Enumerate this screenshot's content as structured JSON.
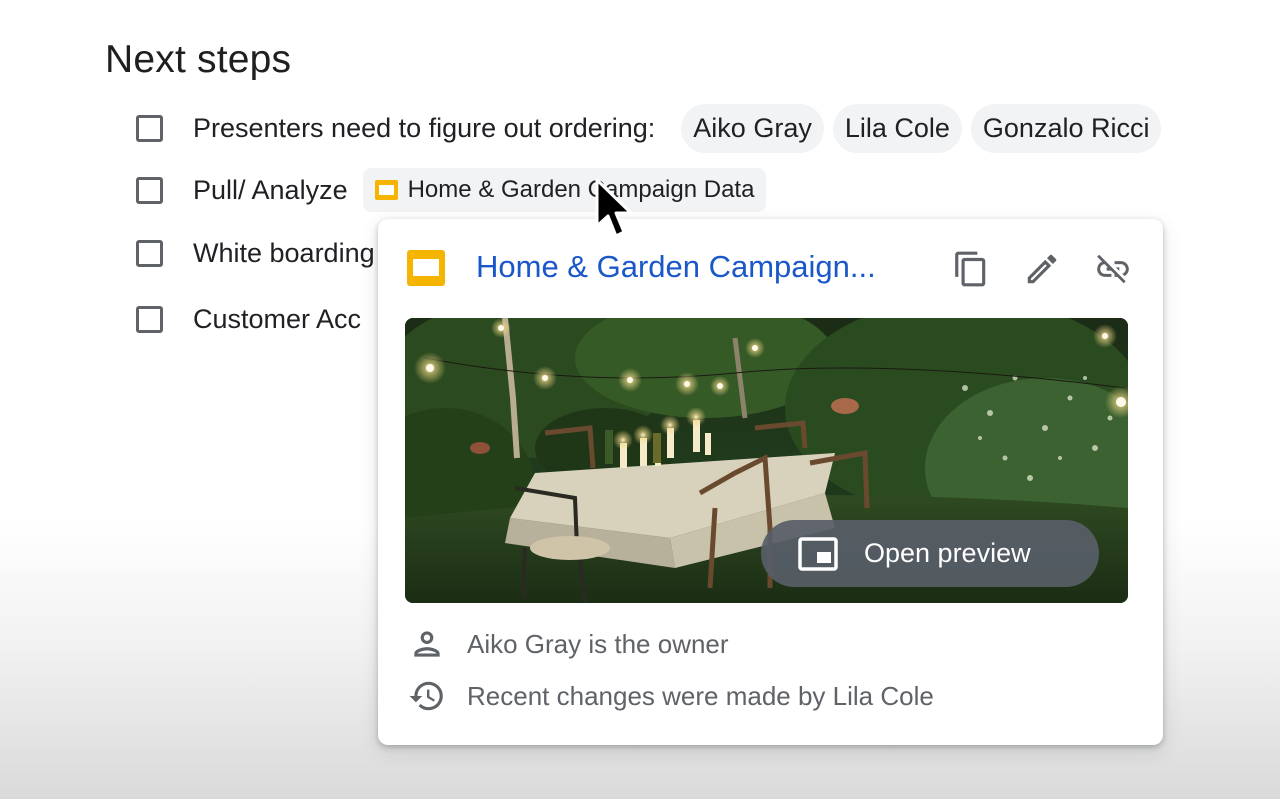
{
  "heading": "Next steps",
  "tasks": [
    {
      "text": "Presenters need to figure out ordering:",
      "chips": [
        "Aiko Gray",
        "Lila Cole",
        "Gonzalo Ricci"
      ]
    },
    {
      "text": "Pull/ Analyze",
      "file_chip": "Home & Garden Campaign Data"
    },
    {
      "text": "White boarding"
    },
    {
      "text": "Customer Acc"
    }
  ],
  "card": {
    "title": "Home & Garden Campaign...",
    "open_preview_label": "Open preview",
    "owner_text": "Aiko Gray is the owner",
    "changes_text": "Recent changes were made by Lila Cole",
    "icons": {
      "file": "slides-icon",
      "copy": "copy-icon",
      "edit": "pencil-icon",
      "unlink": "unlink-icon",
      "owner": "person-icon",
      "history": "history-icon",
      "preview": "picture-in-picture-icon"
    }
  },
  "colors": {
    "title_link": "#1a57c9",
    "slides_yellow": "#f4b400",
    "chip_bg": "#f1f3f4",
    "preview_button_bg": "#585e68",
    "secondary_text": "#5f6368"
  }
}
